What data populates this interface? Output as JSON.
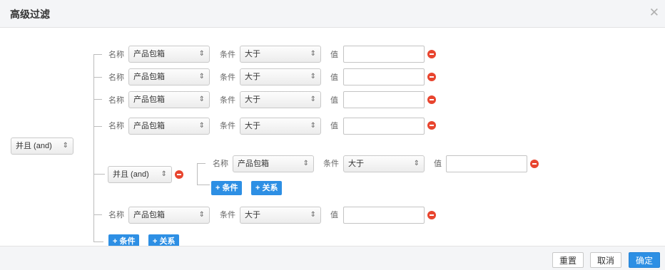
{
  "dialog": {
    "title": "高级过滤",
    "close_icon": "close-icon"
  },
  "labels": {
    "name": "名称",
    "condition": "条件",
    "value": "值"
  },
  "root": {
    "operator": "并且 (and)"
  },
  "conditions": [
    {
      "field": "产品包箱",
      "operator": "大于",
      "value": ""
    },
    {
      "field": "产品包箱",
      "operator": "大于",
      "value": ""
    },
    {
      "field": "产品包箱",
      "operator": "大于",
      "value": ""
    },
    {
      "field": "产品包箱",
      "operator": "大于",
      "value": ""
    }
  ],
  "group": {
    "operator": "并且 (and)",
    "condition": {
      "field": "产品包箱",
      "operator": "大于",
      "value": ""
    },
    "add_condition": "+ 条件",
    "add_relation": "+ 关系"
  },
  "last_condition": {
    "field": "产品包箱",
    "operator": "大于",
    "value": ""
  },
  "root_add_condition": "+ 条件",
  "root_add_relation": "+ 关系",
  "footer": {
    "reset": "重置",
    "cancel": "取消",
    "confirm": "确定"
  },
  "colors": {
    "primary": "#2d8fe4",
    "remove": "#e8452f",
    "header_bg": "#f4f5f7"
  }
}
